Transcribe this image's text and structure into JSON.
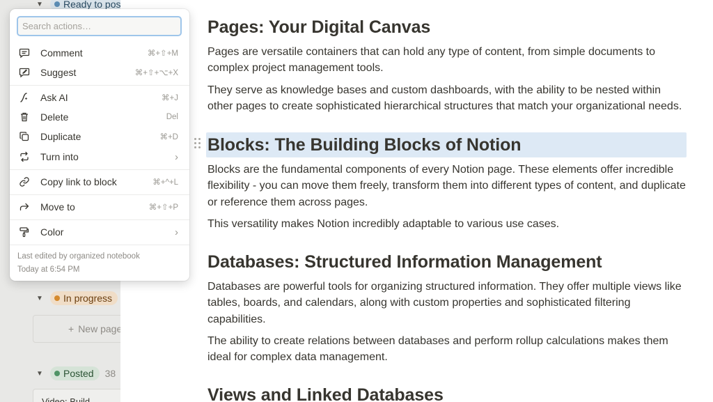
{
  "board": {
    "groups": [
      {
        "label": "Ready to post",
        "count": ""
      },
      {
        "label": "In progress",
        "count": ""
      },
      {
        "label": "Posted",
        "count": "38"
      }
    ],
    "new_page_label": "New page",
    "peek_card_title": "Video: Build"
  },
  "menu": {
    "search_placeholder": "Search actions…",
    "items": [
      {
        "label": "Comment",
        "shortcut": "⌘+⇧+M",
        "icon": "comment-icon"
      },
      {
        "label": "Suggest",
        "shortcut": "⌘+⇧+⌥+X",
        "icon": "suggest-icon"
      },
      {
        "label": "Ask AI",
        "shortcut": "⌘+J",
        "icon": "ai-icon"
      },
      {
        "label": "Delete",
        "shortcut": "Del",
        "icon": "trash-icon"
      },
      {
        "label": "Duplicate",
        "shortcut": "⌘+D",
        "icon": "duplicate-icon"
      },
      {
        "label": "Turn into",
        "shortcut": "",
        "icon": "turn-into-icon"
      },
      {
        "label": "Copy link to block",
        "shortcut": "⌘+^+L",
        "icon": "link-icon"
      },
      {
        "label": "Move to",
        "shortcut": "⌘+⇧+P",
        "icon": "move-arrow-icon"
      },
      {
        "label": "Color",
        "shortcut": "",
        "icon": "paint-roller-icon"
      }
    ],
    "last_edited_by": "Last edited by organized notebook",
    "last_edited_time": "Today at 6:54 PM"
  },
  "document": {
    "h_pages": "Pages: Your Digital Canvas",
    "p_pages_1": "Pages are versatile containers that can hold any type of content, from simple documents to complex project management tools.",
    "p_pages_2": "They serve as knowledge bases and custom dashboards, with the ability to be nested within other pages to create sophisticated hierarchical structures that match your organizational needs.",
    "h_blocks": "Blocks: The Building Blocks of Notion",
    "p_blocks_1": "Blocks are the fundamental components of every Notion page. These elements offer incredible flexibility - you can move them freely, transform them into different types of content, and duplicate or reference them across pages.",
    "p_blocks_2": "This versatility makes Notion incredibly adaptable to various use cases.",
    "h_databases": "Databases: Structured Information Management",
    "p_db_1": "Databases are powerful tools for organizing structured information. They offer multiple views like tables, boards, and calendars, along with custom properties and sophisticated filtering capabilities.",
    "p_db_2": "The ability to create relations between databases and perform rollup calculations makes them ideal for complex data management.",
    "h_views": "Views and Linked Databases"
  },
  "colors": {
    "selection_highlight": "#dde9f5",
    "search_focus_ring": "#9ec5ea",
    "dimmed_panel": "#e8e8e6"
  }
}
